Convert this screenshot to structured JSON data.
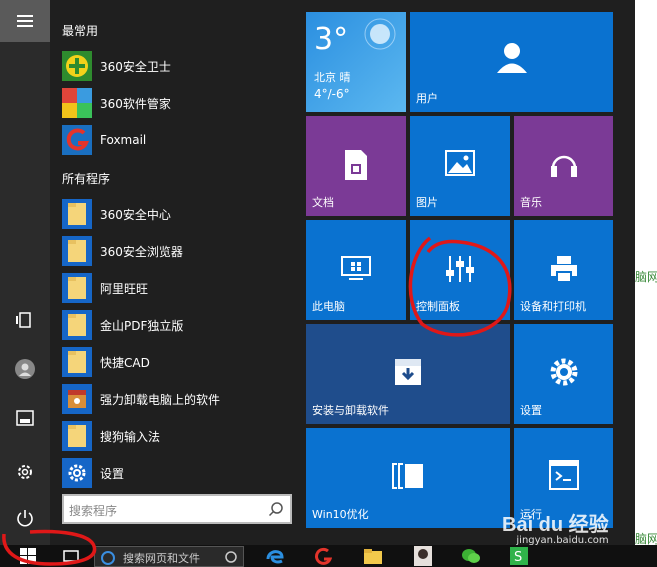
{
  "colors": {
    "blue": "#0a72d0",
    "purple": "#7b3a96",
    "dark_blue": "#1f4d8c",
    "weather": "#3fa1ea"
  },
  "sections": {
    "frequent": "最常用",
    "all": "所有程序"
  },
  "frequent_apps": [
    {
      "label": "360安全卫士",
      "icon": "360-safe-icon"
    },
    {
      "label": "360软件管家",
      "icon": "360-manager-icon"
    },
    {
      "label": "Foxmail",
      "icon": "foxmail-icon"
    }
  ],
  "all_apps": [
    {
      "label": "360安全中心",
      "icon": "folder-icon"
    },
    {
      "label": "360安全浏览器",
      "icon": "folder-icon"
    },
    {
      "label": "阿里旺旺",
      "icon": "folder-icon"
    },
    {
      "label": "金山PDF独立版",
      "icon": "folder-icon"
    },
    {
      "label": "快捷CAD",
      "icon": "folder-icon"
    },
    {
      "label": "强力卸载电脑上的软件",
      "icon": "uninstall-icon"
    },
    {
      "label": "搜狗输入法",
      "icon": "folder-icon"
    },
    {
      "label": "设置",
      "icon": "gear-icon"
    }
  ],
  "search": {
    "placeholder": "搜索程序"
  },
  "weather": {
    "temp": "3°",
    "city": "北京 晴",
    "range": "4°/-6°"
  },
  "tiles": {
    "user": "用户",
    "documents": "文档",
    "pictures": "图片",
    "music": "音乐",
    "this_pc": "此电脑",
    "control_panel": "控制面板",
    "devices": "设备和打印机",
    "install": "安装与卸载软件",
    "settings": "设置",
    "win10": "Win10优化",
    "run": "运行"
  },
  "taskbar": {
    "search_text": "搜索网页和文件"
  },
  "watermark": {
    "brand": "Bai du 经验",
    "url": "jingyan.baidu.com"
  }
}
